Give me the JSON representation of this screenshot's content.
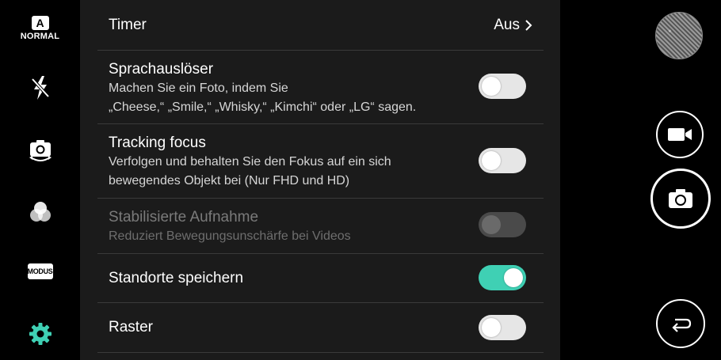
{
  "left_rail": {
    "mode_letter": "A",
    "mode_label": "NORMAL",
    "modus_label": "MODUS",
    "icons": [
      "flash-off-icon",
      "switch-camera-icon",
      "filter-icon",
      "gear-icon"
    ],
    "accent_color": "#3fd0b4"
  },
  "settings": {
    "timer": {
      "title": "Timer",
      "value": "Aus"
    },
    "voice_shutter": {
      "title": "Sprachauslöser",
      "desc_line1": "Machen Sie ein Foto, indem Sie",
      "desc_line2": "„Cheese,“ „Smile,“ „Whisky,“ „Kimchi“ oder „LG“ sagen.",
      "enabled": false
    },
    "tracking_focus": {
      "title": "Tracking focus",
      "desc_line1": "Verfolgen und behalten Sie den Fokus auf ein sich",
      "desc_line2": "bewegendes Objekt bei (Nur FHD und HD)",
      "enabled": false
    },
    "stabilized": {
      "title": "Stabilisierte Aufnahme",
      "desc_line1": "Reduziert Bewegungsunschärfe bei Videos",
      "enabled": false,
      "disabled": true
    },
    "save_location": {
      "title": "Standorte speichern",
      "enabled": true
    },
    "grid": {
      "title": "Raster",
      "enabled": false
    }
  },
  "right_rail": {
    "icons": [
      "gallery-thumbnail",
      "video-camera-icon",
      "camera-icon",
      "back-arrow-icon"
    ]
  }
}
